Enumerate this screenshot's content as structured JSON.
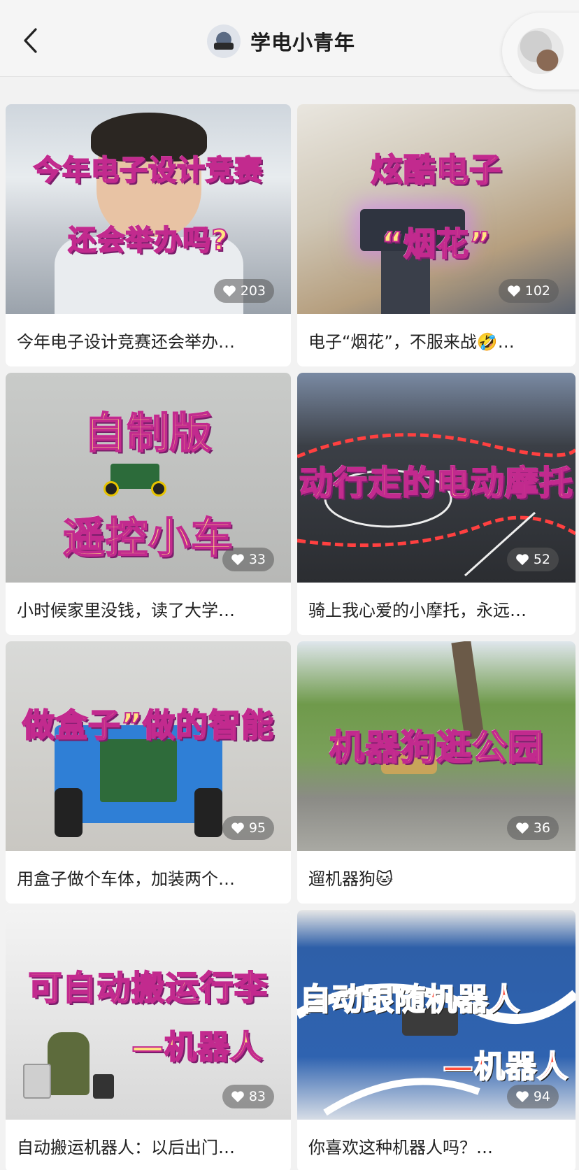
{
  "header": {
    "channel_name": "学电小青年",
    "icons": {
      "back": "chevron-left-icon",
      "channel_avatar": "channel-avatar-image",
      "user_avatar": "user-avatar-image"
    }
  },
  "cards": [
    {
      "overlay": [
        "今年电子设计竞赛",
        "还会举办吗?"
      ],
      "likes": "203",
      "caption": "今年电子设计竞赛还会举办…"
    },
    {
      "overlay": [
        "炫酷电子",
        "“烟花”"
      ],
      "likes": "102",
      "caption": "电子“烟花”，不服来战🤣…"
    },
    {
      "overlay": [
        "自制版",
        "遥控小车"
      ],
      "likes": "33",
      "caption": "小时候家里没钱，读了大学…"
    },
    {
      "overlay": [
        "动行走的电动摩托"
      ],
      "likes": "52",
      "caption": "骑上我心爱的小摩托，永远…"
    },
    {
      "overlay": [
        "做盒子”做的智能"
      ],
      "likes": "95",
      "caption": "用盒子做个车体，加装两个…"
    },
    {
      "overlay": [
        "机器狗逛公园"
      ],
      "likes": "36",
      "caption": "遛机器狗🐱"
    },
    {
      "overlay": [
        "可自动搬运行李",
        "—机器人"
      ],
      "likes": "83",
      "caption": "自动搬运机器人：以后出门…"
    },
    {
      "overlay": [
        "自动跟随机器人",
        "—机器人"
      ],
      "likes": "94",
      "caption": "你喜欢这种机器人吗？…"
    }
  ],
  "colors": {
    "overlay_fill": "#ffe680",
    "overlay_stroke": "#c22a8e",
    "background": "#f2f2f2"
  }
}
